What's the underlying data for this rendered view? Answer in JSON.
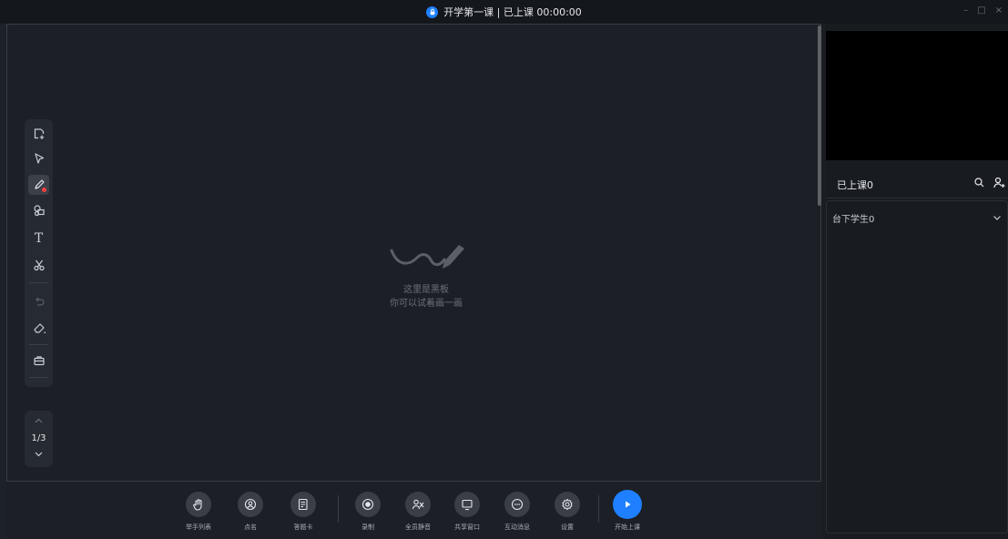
{
  "titlebar": {
    "title": "开学第一课 | 已上课 00:00:00",
    "lock_icon": "lock-icon",
    "minimize": "–",
    "maximize": "□",
    "close": "×",
    "accent": "#1e80ff"
  },
  "toolbar_left": {
    "tools": [
      {
        "name": "add-page-tool",
        "icon": "add-page-icon"
      },
      {
        "name": "select-tool",
        "icon": "cursor-icon"
      },
      {
        "name": "pen-tool",
        "icon": "pen-icon",
        "active": true
      },
      {
        "name": "shape-tool",
        "icon": "shapes-icon"
      },
      {
        "name": "text-tool",
        "icon": "text-icon",
        "glyph": "T"
      },
      {
        "name": "scissors-tool",
        "icon": "scissors-icon"
      },
      {
        "name": "undo-tool",
        "icon": "undo-icon"
      },
      {
        "name": "eraser-tool",
        "icon": "eraser-icon"
      },
      {
        "name": "toolbox-tool",
        "icon": "toolbox-icon"
      }
    ]
  },
  "pager": {
    "label": "1/3",
    "current": 1,
    "total": 3
  },
  "board": {
    "line1": "这里是黑板",
    "line2": "你可以试着画一画",
    "icon": "pen-stroke-icon"
  },
  "bottom_toolbar": {
    "buttons": [
      {
        "label": "举手列表",
        "icon": "raise-hand-icon"
      },
      {
        "label": "点名",
        "icon": "roll-call-icon"
      },
      {
        "label": "答题卡",
        "icon": "answer-card-icon"
      },
      {
        "label": "录制",
        "icon": "record-icon"
      },
      {
        "label": "全员静音",
        "icon": "mute-all-icon"
      },
      {
        "label": "共享窗口",
        "icon": "share-window-icon"
      },
      {
        "label": "互动消息",
        "icon": "chat-icon"
      },
      {
        "label": "设置",
        "icon": "settings-icon"
      },
      {
        "label": "开始上课",
        "icon": "play-icon",
        "primary": true
      }
    ]
  },
  "right_panel": {
    "online_title": "已上课0",
    "search_icon": "search-icon",
    "add_user_icon": "add-user-icon",
    "students_title": "台下学生0",
    "students_chevron": "chevron-down-icon"
  }
}
